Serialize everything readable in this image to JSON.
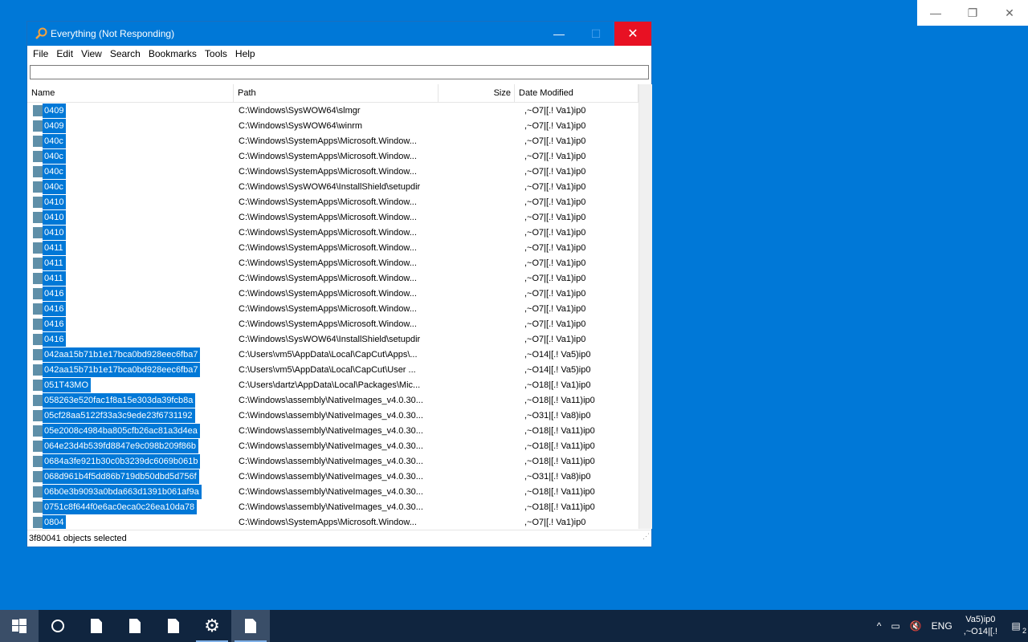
{
  "background_window": {
    "minimize": "—",
    "restore": "❐",
    "close": "✕"
  },
  "window": {
    "title": "Everything (Not Responding)",
    "controls": {
      "minimize": "—",
      "maximize": "☐",
      "close": "✕"
    },
    "menu": [
      "File",
      "Edit",
      "View",
      "Search",
      "Bookmarks",
      "Tools",
      "Help"
    ],
    "search_value": "",
    "columns": [
      "Name",
      "Path",
      "Size",
      "Date Modified"
    ],
    "rows": [
      {
        "name": "0409",
        "path": "C:\\Windows\\SysWOW64\\slmgr",
        "size": "",
        "date": ",~O7|[.! Va1)ip0"
      },
      {
        "name": "0409",
        "path": "C:\\Windows\\SysWOW64\\winrm",
        "size": "",
        "date": ",~O7|[.! Va1)ip0"
      },
      {
        "name": "040c",
        "path": "C:\\Windows\\SystemApps\\Microsoft.Window...",
        "size": "",
        "date": ",~O7|[.! Va1)ip0"
      },
      {
        "name": "040c",
        "path": "C:\\Windows\\SystemApps\\Microsoft.Window...",
        "size": "",
        "date": ",~O7|[.! Va1)ip0"
      },
      {
        "name": "040c",
        "path": "C:\\Windows\\SystemApps\\Microsoft.Window...",
        "size": "",
        "date": ",~O7|[.! Va1)ip0"
      },
      {
        "name": "040c",
        "path": "C:\\Windows\\SysWOW64\\InstallShield\\setupdir",
        "size": "",
        "date": ",~O7|[.! Va1)ip0"
      },
      {
        "name": "0410",
        "path": "C:\\Windows\\SystemApps\\Microsoft.Window...",
        "size": "",
        "date": ",~O7|[.! Va1)ip0"
      },
      {
        "name": "0410",
        "path": "C:\\Windows\\SystemApps\\Microsoft.Window...",
        "size": "",
        "date": ",~O7|[.! Va1)ip0"
      },
      {
        "name": "0410",
        "path": "C:\\Windows\\SystemApps\\Microsoft.Window...",
        "size": "",
        "date": ",~O7|[.! Va1)ip0"
      },
      {
        "name": "0411",
        "path": "C:\\Windows\\SystemApps\\Microsoft.Window...",
        "size": "",
        "date": ",~O7|[.! Va1)ip0"
      },
      {
        "name": "0411",
        "path": "C:\\Windows\\SystemApps\\Microsoft.Window...",
        "size": "",
        "date": ",~O7|[.! Va1)ip0"
      },
      {
        "name": "0411",
        "path": "C:\\Windows\\SystemApps\\Microsoft.Window...",
        "size": "",
        "date": ",~O7|[.! Va1)ip0"
      },
      {
        "name": "0416",
        "path": "C:\\Windows\\SystemApps\\Microsoft.Window...",
        "size": "",
        "date": ",~O7|[.! Va1)ip0"
      },
      {
        "name": "0416",
        "path": "C:\\Windows\\SystemApps\\Microsoft.Window...",
        "size": "",
        "date": ",~O7|[.! Va1)ip0"
      },
      {
        "name": "0416",
        "path": "C:\\Windows\\SystemApps\\Microsoft.Window...",
        "size": "",
        "date": ",~O7|[.! Va1)ip0"
      },
      {
        "name": "0416",
        "path": "C:\\Windows\\SysWOW64\\InstallShield\\setupdir",
        "size": "",
        "date": ",~O7|[.! Va1)ip0"
      },
      {
        "name": "042aa15b71b1e17bca0bd928eec6fba7",
        "path": "C:\\Users\\vm5\\AppData\\Local\\CapCut\\Apps\\...",
        "size": "",
        "date": ",~O14|[.! Va5)ip0"
      },
      {
        "name": "042aa15b71b1e17bca0bd928eec6fba7",
        "path": "C:\\Users\\vm5\\AppData\\Local\\CapCut\\User ...",
        "size": "",
        "date": ",~O14|[.! Va5)ip0"
      },
      {
        "name": "051T43MO",
        "path": "C:\\Users\\dartz\\AppData\\Local\\Packages\\Mic...",
        "size": "",
        "date": ",~O18|[.! Va1)ip0"
      },
      {
        "name": "058263e520fac1f8a15e303da39fcb8a",
        "path": "C:\\Windows\\assembly\\NativeImages_v4.0.30...",
        "size": "",
        "date": ",~O18|[.! Va11)ip0"
      },
      {
        "name": "05cf28aa5122f33a3c9ede23f6731192",
        "path": "C:\\Windows\\assembly\\NativeImages_v4.0.30...",
        "size": "",
        "date": ",~O31|[.! Va8)ip0"
      },
      {
        "name": "05e2008c4984ba805cfb26ac81a3d4ea",
        "path": "C:\\Windows\\assembly\\NativeImages_v4.0.30...",
        "size": "",
        "date": ",~O18|[.! Va11)ip0"
      },
      {
        "name": "064e23d4b539fd8847e9c098b209f86b",
        "path": "C:\\Windows\\assembly\\NativeImages_v4.0.30...",
        "size": "",
        "date": ",~O18|[.! Va11)ip0"
      },
      {
        "name": "0684a3fe921b30c0b3239dc6069b061b",
        "path": "C:\\Windows\\assembly\\NativeImages_v4.0.30...",
        "size": "",
        "date": ",~O18|[.! Va11)ip0"
      },
      {
        "name": "068d961b4f5dd86b719db50dbd5d756f",
        "path": "C:\\Windows\\assembly\\NativeImages_v4.0.30...",
        "size": "",
        "date": ",~O31|[.! Va8)ip0"
      },
      {
        "name": "06b0e3b9093a0bda663d1391b061af9a",
        "path": "C:\\Windows\\assembly\\NativeImages_v4.0.30...",
        "size": "",
        "date": ",~O18|[.! Va11)ip0"
      },
      {
        "name": "0751c8f644f0e6ac0eca0c26ea10da78",
        "path": "C:\\Windows\\assembly\\NativeImages_v4.0.30...",
        "size": "",
        "date": ",~O18|[.! Va11)ip0"
      },
      {
        "name": "0804",
        "path": "C:\\Windows\\SystemApps\\Microsoft.Window...",
        "size": "",
        "date": ",~O7|[.! Va1)ip0"
      }
    ],
    "status": "3f80041 objects selected"
  },
  "taskbar": {
    "apps": [
      {
        "name": "start",
        "icon": "windows-logo-icon"
      },
      {
        "name": "cortana",
        "icon": "circle-icon"
      },
      {
        "name": "file-1",
        "icon": "document-icon"
      },
      {
        "name": "file-2",
        "icon": "document-icon"
      },
      {
        "name": "file-3",
        "icon": "document-icon"
      },
      {
        "name": "settings",
        "icon": "gear-icon"
      },
      {
        "name": "file-active",
        "icon": "document-icon"
      }
    ],
    "tray": {
      "chevron": "^",
      "language": "ENG",
      "clock_line1": "Va5)ip0",
      "clock_line2": ",~O14|[.!",
      "notification_count": "2"
    }
  },
  "colors": {
    "accent": "#0078d7",
    "taskbar": "#10253f",
    "close": "#e81123",
    "selection": "#0078d7"
  }
}
